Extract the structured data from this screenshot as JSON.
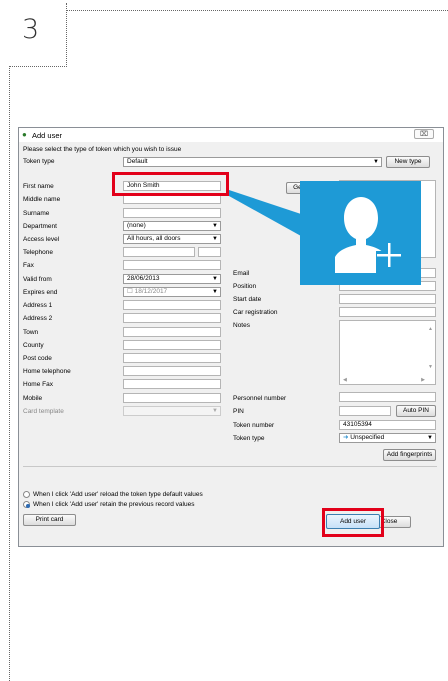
{
  "step": {
    "number": "3"
  },
  "window": {
    "title": "Add user",
    "close_label": "⌧"
  },
  "instruction": "Please select the type of token which you wish to issue",
  "token_type": {
    "label": "Token type",
    "value": "Default",
    "new_type_button": "New type"
  },
  "fields_left": {
    "first_name": {
      "label": "First name",
      "value": "John Smith"
    },
    "middle_name": {
      "label": "Middle name",
      "value": ""
    },
    "surname": {
      "label": "Surname",
      "value": ""
    },
    "department": {
      "label": "Department",
      "value": "(none)"
    },
    "access_level": {
      "label": "Access level",
      "value": "All hours, all doors"
    },
    "telephone": {
      "label": "Telephone",
      "value": ""
    },
    "fax": {
      "label": "Fax",
      "value": ""
    },
    "valid_from": {
      "label": "Valid from",
      "value": "28/06/2013"
    },
    "expires_end": {
      "label": "Expires end",
      "value": "18/12/2017"
    },
    "address1": {
      "label": "Address 1",
      "value": ""
    },
    "address2": {
      "label": "Address 2",
      "value": ""
    },
    "town": {
      "label": "Town",
      "value": ""
    },
    "county": {
      "label": "County",
      "value": ""
    },
    "post_code": {
      "label": "Post code",
      "value": ""
    },
    "home_telephone": {
      "label": "Home telephone",
      "value": ""
    },
    "home_fax": {
      "label": "Home Fax",
      "value": ""
    },
    "mobile": {
      "label": "Mobile",
      "value": ""
    },
    "card_template": {
      "label": "Card template",
      "value": ""
    }
  },
  "fields_right": {
    "get_picture_button": "Get picture",
    "email": {
      "label": "Email",
      "value": ""
    },
    "position": {
      "label": "Position",
      "value": ""
    },
    "start_date": {
      "label": "Start date",
      "value": ""
    },
    "car_registration": {
      "label": "Car registration",
      "value": ""
    },
    "notes": {
      "label": "Notes",
      "value": ""
    },
    "personnel_number": {
      "label": "Personnel number",
      "value": ""
    },
    "pin": {
      "label": "PIN",
      "value": ""
    },
    "auto_pin_button": "Auto PIN",
    "token_number": {
      "label": "Token number",
      "value": "43105394"
    },
    "token_type2": {
      "label": "Token type",
      "value": "Unspecified"
    },
    "add_fingerprints_button": "Add fingerprints"
  },
  "options": {
    "radio1": "When I click 'Add user' reload the token type default values",
    "radio2": "When I click 'Add user' retain the previous record values",
    "selected": 2
  },
  "buttons": {
    "print_card": "Print card",
    "close": "Close",
    "add_user": "Add user"
  },
  "colors": {
    "highlight": "#e2001a",
    "card": "#1e9ad6"
  },
  "icons": {
    "add_user_overlay": "add-user-icon",
    "window_icon": "user-icon"
  }
}
